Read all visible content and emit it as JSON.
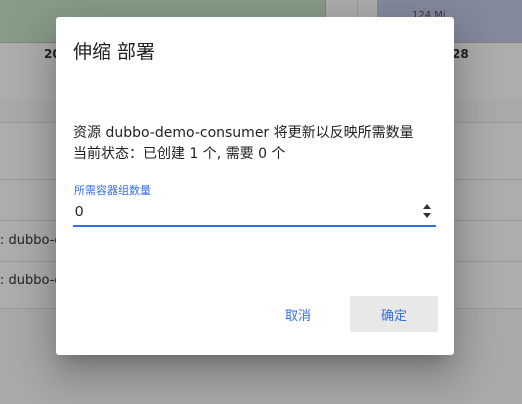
{
  "background": {
    "chart": {
      "tick_left": "20",
      "tick_right": "28",
      "yaxis_label": "124 Mi",
      "colors": {
        "green_area": "#c8e6c9",
        "blue_area": "#c5cae9"
      }
    },
    "rows": [
      {
        "text": ": dubbo-c"
      },
      {
        "text": ": dubbo-c"
      }
    ]
  },
  "dialog": {
    "title": "伸缩 部署",
    "description_line1": "资源 dubbo-demo-consumer 将更新以反映所需数量",
    "description_line2": "当前状态：已创建 1 个, 需要 0 个",
    "field": {
      "label": "所需容器组数量",
      "value": "0"
    },
    "buttons": {
      "cancel": "取消",
      "ok": "确定"
    },
    "accent_color": "#326de6"
  }
}
